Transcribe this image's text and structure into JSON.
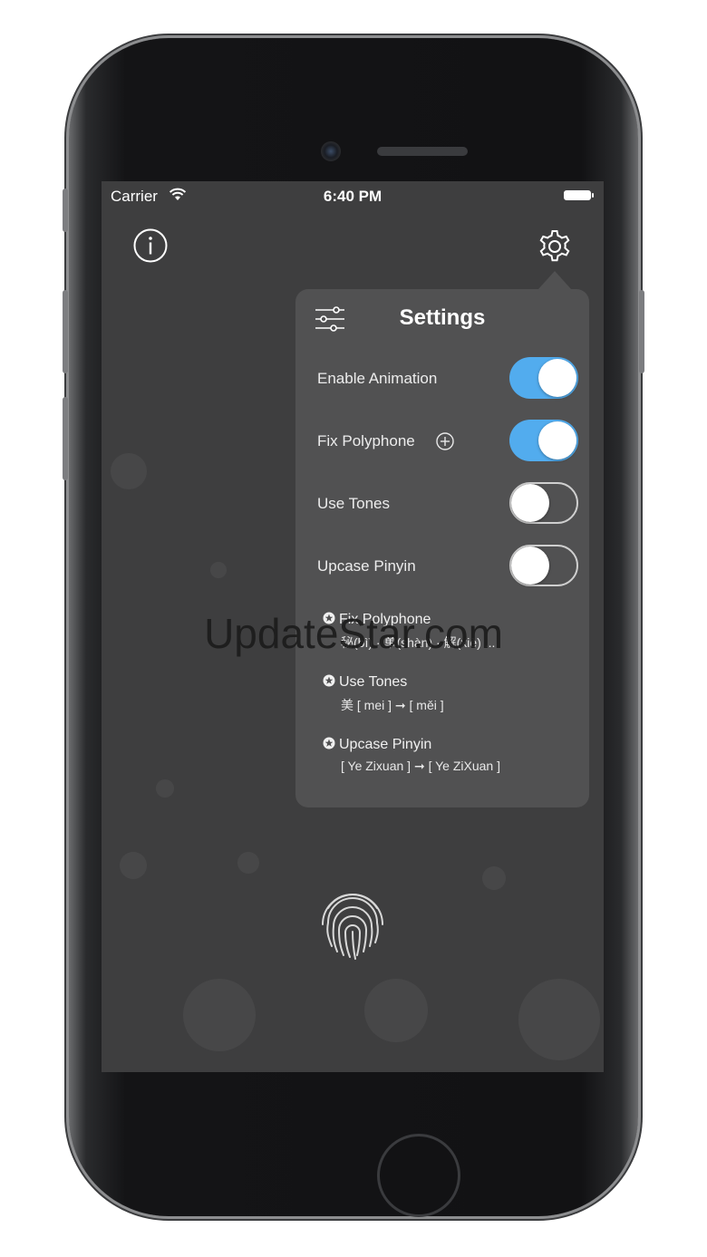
{
  "status_bar": {
    "carrier": "Carrier",
    "time": "6:40 PM"
  },
  "settings": {
    "title": "Settings",
    "toggles": [
      {
        "label": "Enable Animation",
        "on": true
      },
      {
        "label": "Fix Polyphone",
        "on": true
      },
      {
        "label": "Use Tones",
        "on": false
      },
      {
        "label": "Upcase Pinyin",
        "on": false
      }
    ],
    "notes": [
      {
        "title": "Fix Polyphone",
        "example": "秘(bì) · 单(shàn) · 解(xiè) ..."
      },
      {
        "title": "Use Tones",
        "example": "美 [ mei ] ➞ [ měi ]"
      },
      {
        "title": "Upcase Pinyin",
        "example": "[ Ye Zixuan ] ➞ [ Ye ZiXuan ]"
      }
    ]
  },
  "icons": {
    "info": "info-icon",
    "gear": "gear-icon",
    "sliders": "sliders-icon",
    "plus": "plus-circle-icon",
    "star": "star-icon",
    "fingerprint": "fingerprint-icon",
    "wifi": "wifi-icon",
    "battery": "battery-icon"
  },
  "colors": {
    "screen_bg": "#3e3e3f",
    "popover_bg": "#515152",
    "toggle_on": "#52acee"
  },
  "watermark": "UpdateStar.com"
}
